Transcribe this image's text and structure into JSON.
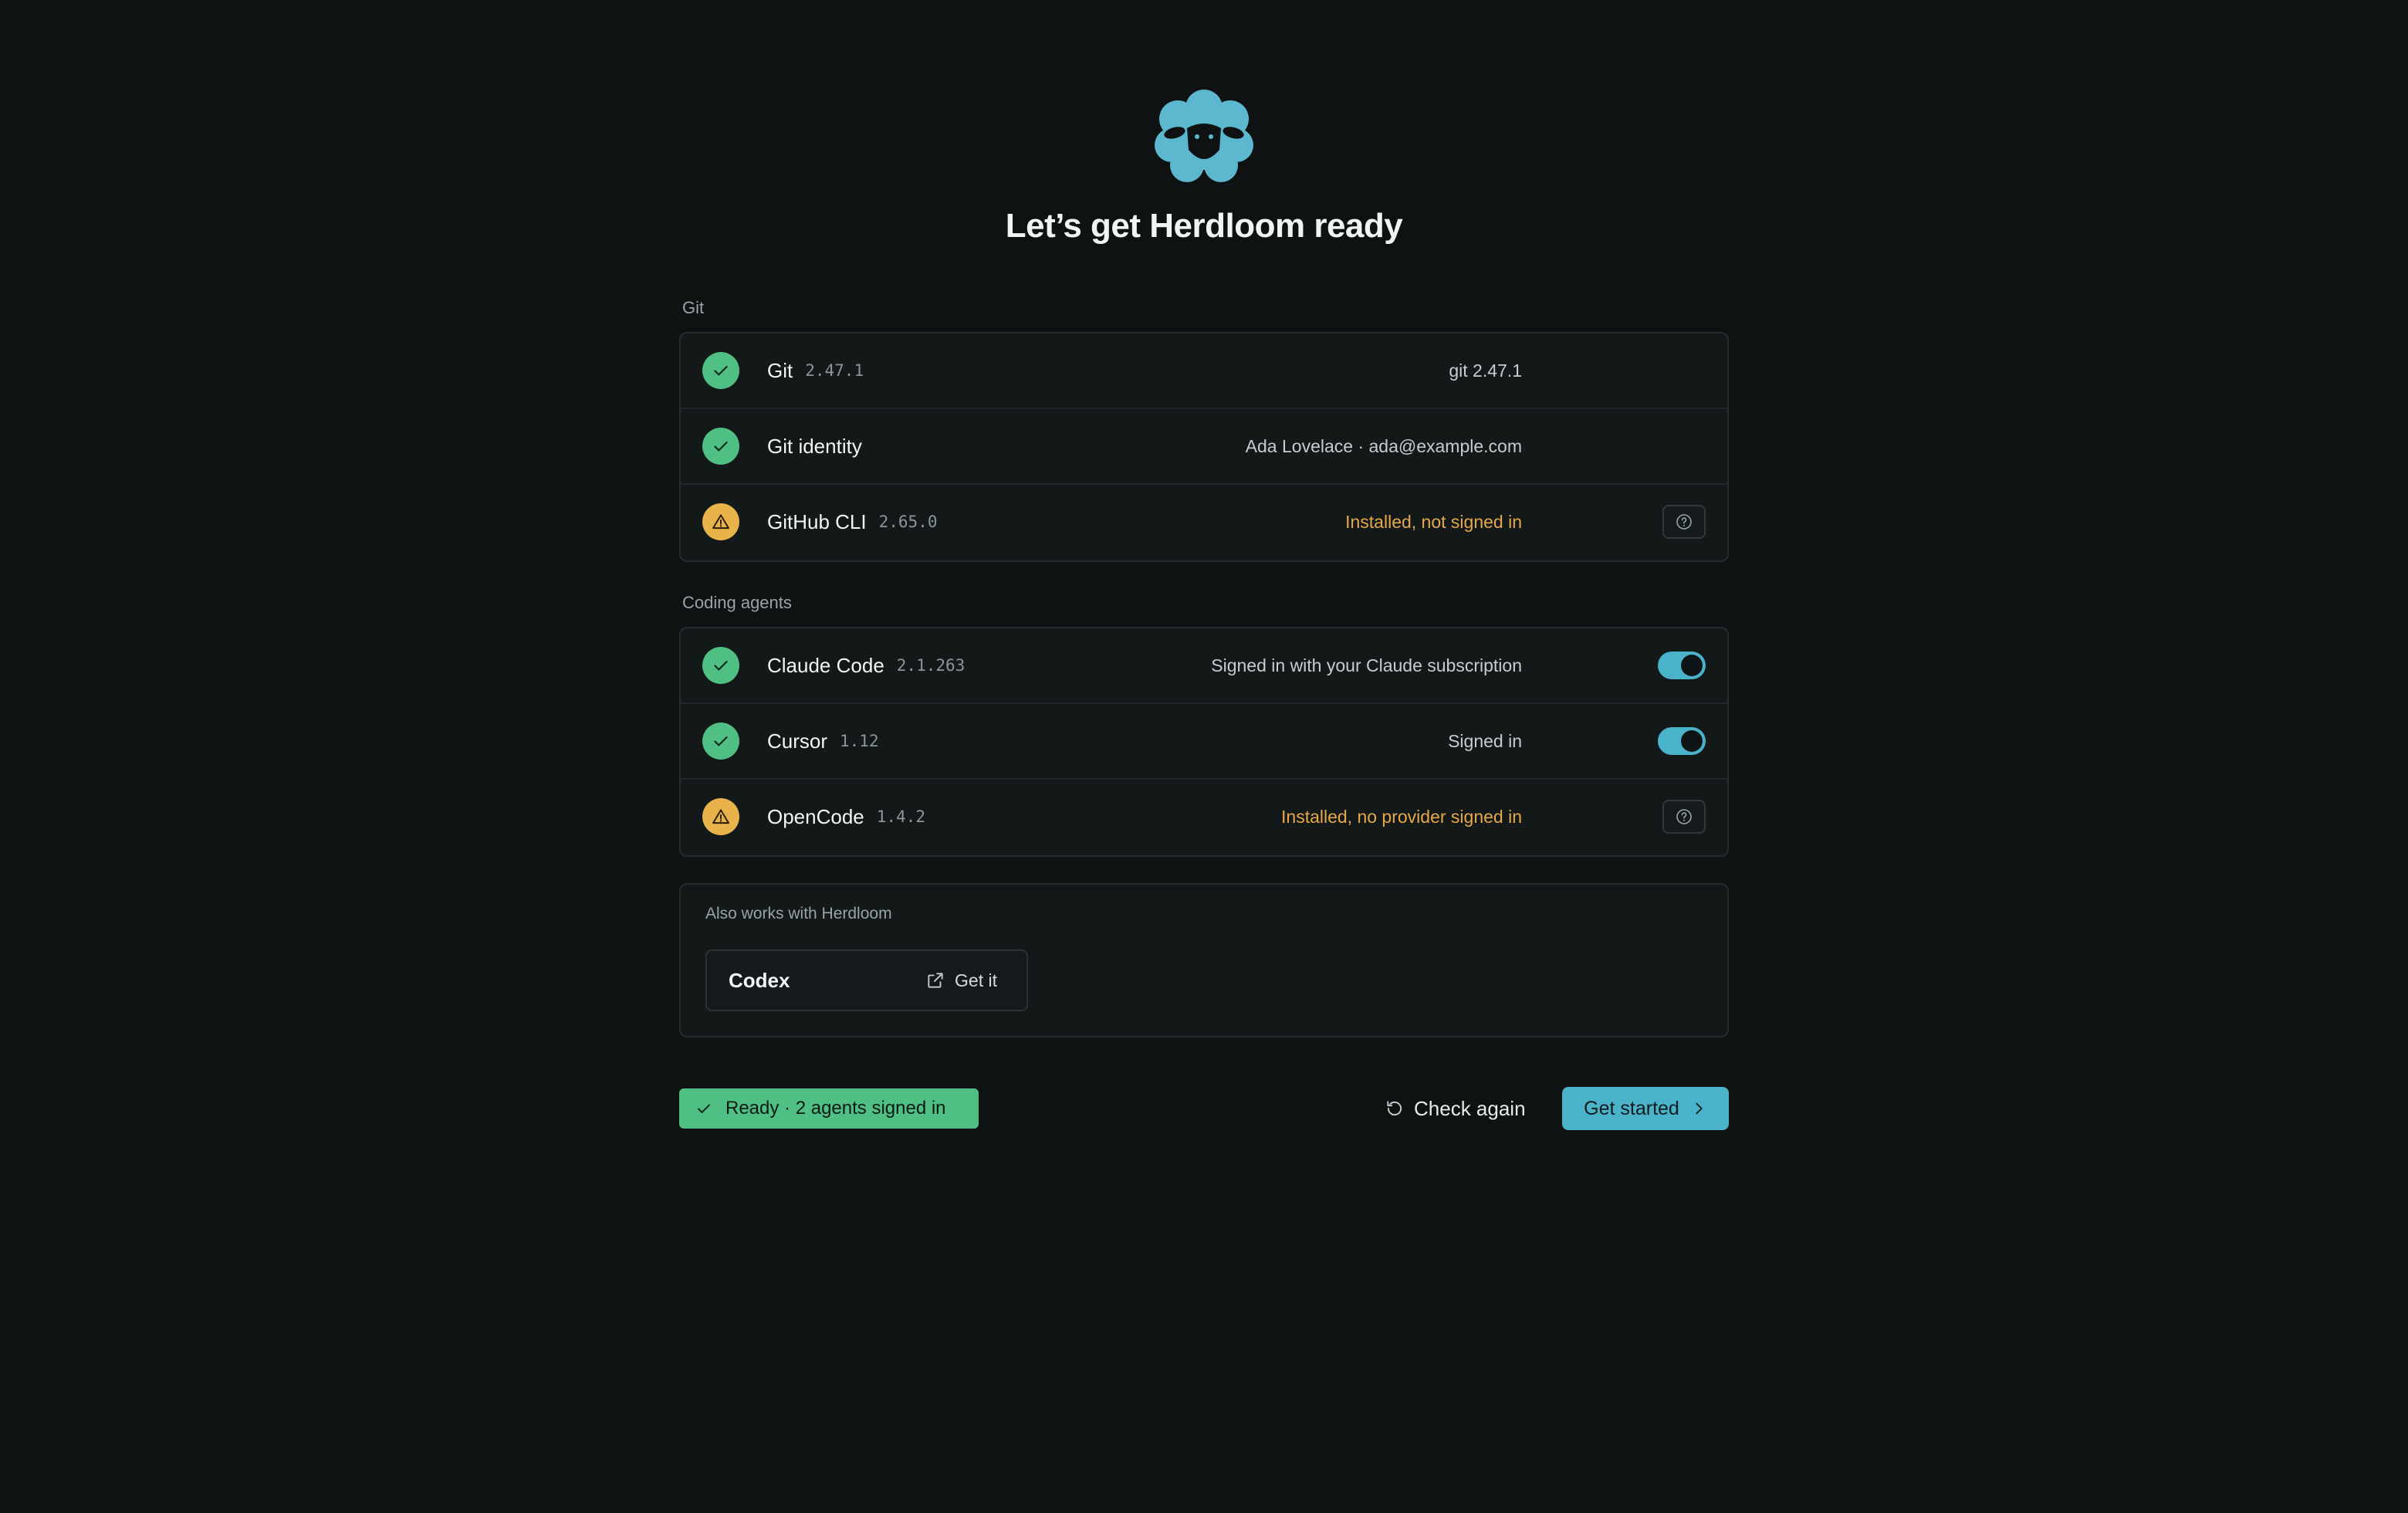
{
  "header": {
    "logo": "sheep-icon",
    "title": "Let’s get Herdloom ready"
  },
  "git_section": {
    "label": "Git",
    "rows": [
      {
        "name": "Git",
        "version": "2.47.1",
        "status": "git 2.47.1",
        "state": "ok"
      },
      {
        "name": "Git identity",
        "version": "",
        "status": "Ada Lovelace · ada@example.com",
        "state": "ok"
      },
      {
        "name": "GitHub CLI",
        "version": "2.65.0",
        "status": "Installed, not signed in",
        "state": "warn",
        "action": "help-icon"
      }
    ]
  },
  "agents_section": {
    "label": "Coding agents",
    "rows": [
      {
        "name": "Claude Code",
        "version": "2.1.263",
        "status": "Signed in with your Claude subscription",
        "state": "ok",
        "enabled": true
      },
      {
        "name": "Cursor",
        "version": "1.12",
        "status": "Signed in",
        "state": "ok",
        "enabled": true
      },
      {
        "name": "OpenCode",
        "version": "1.4.2",
        "status": "Installed, no provider signed in",
        "state": "warn",
        "action": "help-icon"
      }
    ]
  },
  "also_works": {
    "label": "Also works with Herdloom",
    "items": [
      {
        "name": "Codex",
        "action_label": "Get it",
        "action_icon": "external-link-icon"
      }
    ]
  },
  "footer": {
    "ready_label": "Ready · 2 agents signed in",
    "check_again_label": "Check again",
    "get_started_label": "Get started"
  },
  "colors": {
    "background": "#0e1213",
    "accent": "#4bb3c9",
    "ok": "#4fbf84",
    "warn": "#e8b34a"
  }
}
